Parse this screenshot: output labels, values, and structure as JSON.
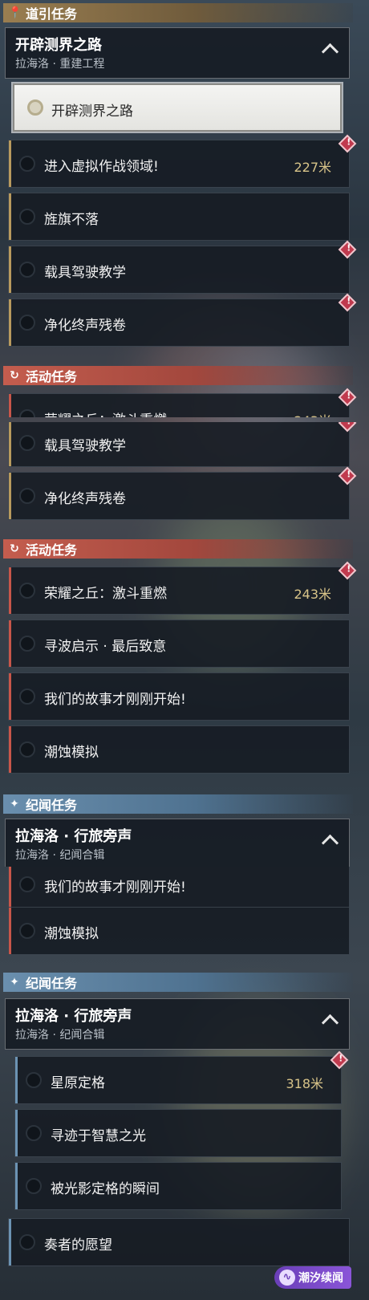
{
  "sections": {
    "guide": {
      "title": "道引任务",
      "icon": "map-pin-icon"
    },
    "event": {
      "title": "活动任务",
      "icon": "refresh-quest-icon"
    },
    "story": {
      "title": "纪闻任务",
      "icon": "sparkle-star-icon"
    }
  },
  "groups": {
    "guide": {
      "title": "开辟测界之路",
      "subtitle": "拉海洛 · 重建工程"
    },
    "story": {
      "title": "拉海洛 · 行旅旁声",
      "subtitle": "拉海洛 · 纪闻合辑",
      "subtitle_partial": "拉海洛 · 纪闻合辑"
    }
  },
  "selected_quest": "开辟测界之路",
  "quests": {
    "virtual_battle": {
      "label": "进入虚拟作战领域!",
      "distance": "227米"
    },
    "flag": {
      "label": "旌旗不落"
    },
    "vehicle": {
      "label": "载具驾驶教学"
    },
    "purify": {
      "label": "净化终声残卷"
    },
    "glory": {
      "label": "荣耀之丘：激斗重燃",
      "distance": "243米"
    },
    "wave": {
      "label": "寻波启示 · 最后致意"
    },
    "story_begin": {
      "label": "我们的故事才刚刚开始!"
    },
    "erosion": {
      "label": "潮蚀模拟"
    },
    "star_plain": {
      "label": "星原定格",
      "distance": "318米"
    },
    "wisdom": {
      "label": "寻迹于智慧之光"
    },
    "moment": {
      "label": "被光影定格的瞬间"
    },
    "player_wish": {
      "label": "奏者的愿望"
    }
  },
  "alert_glyph": "!",
  "watermark": {
    "text": "潮汐续闻",
    "icon": "tide-logo-icon"
  }
}
